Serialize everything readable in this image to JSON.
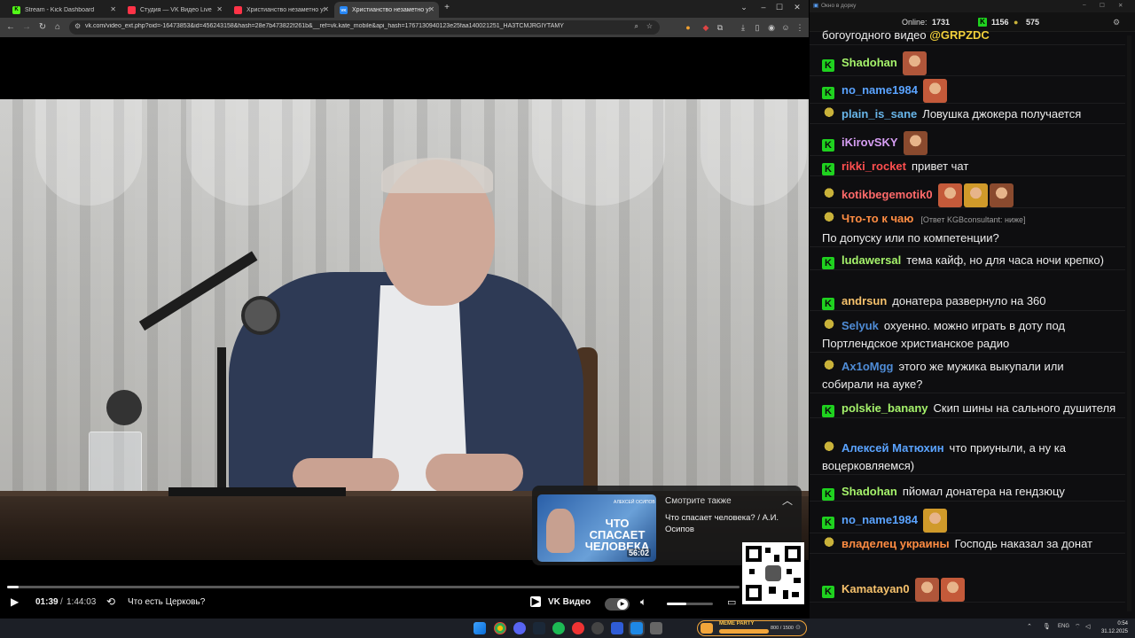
{
  "browser": {
    "tabs": [
      {
        "label": "Stream - Kick Dashboard",
        "fav_color": "#53fc18",
        "fav_glyph": "K",
        "active": false
      },
      {
        "label": "Студия — VK Видео Live",
        "fav_color": "#ff3347",
        "fav_glyph": "",
        "active": false
      },
      {
        "label": "Христианство незаметно ухо",
        "fav_color": "#ff3347",
        "fav_glyph": "",
        "active": false
      },
      {
        "label": "Христианство незаметно ухо",
        "fav_color": "#2787f5",
        "fav_glyph": "VK",
        "active": true
      }
    ],
    "new_tab": "+",
    "url": "vk.com/video_ext.php?oid=-16473853&id=456243158&hash=28e7b473822f261b&__ref=vk.kate_mobile&api_hash=1767130940123e25faa140021251_HA3TCMJRGIYTAMY"
  },
  "video": {
    "see_also_heading": "Смотрите также",
    "see_also_title": "Что спасает человека? / А.И. Осипов",
    "thumb_title": "ЧТО СПАСАЕТ ЧЕЛОВЕКА",
    "thumb_tag": "АЛЕКСЕЙ ОСИПОВ",
    "thumb_duration": "56:02",
    "current_time": "01:39",
    "total_time": "1:44:03",
    "progress_fraction": 0.016,
    "chapter": "Что есть Церковь?",
    "brand": "VK Видео",
    "volume_fraction": 0.42
  },
  "chat": {
    "window_title": "Окно в дорку",
    "online_label": "Online:",
    "online_count": "1731",
    "kick_count": "1156",
    "pepe_count": "575",
    "top_fragment": "богоугодного видео",
    "top_mention": "@GRPZDC",
    "messages": [
      {
        "badge": "kick",
        "user": "Shadohan",
        "color": "#a5f26b",
        "text": "",
        "emotes": 1,
        "reply": ""
      },
      {
        "badge": "kick",
        "user": "no_name1984",
        "color": "#5aa3ff",
        "text": "",
        "emotes": 1,
        "reply": ""
      },
      {
        "badge": "pepe",
        "user": "plain_is_sane",
        "color": "#68b5e8",
        "text": "Ловушка джокера получается",
        "emotes": 0,
        "reply": ""
      },
      {
        "badge": "kick",
        "user": "iKirovSKY",
        "color": "#d69ef3",
        "text": "",
        "emotes": 1,
        "reply": ""
      },
      {
        "badge": "kick",
        "user": "rikki_rocket",
        "color": "#ff4f4f",
        "text": "привет чат",
        "emotes": 0,
        "reply": ""
      },
      {
        "badge": "pepe",
        "user": "kotikbegemotik0",
        "color": "#ff6a6a",
        "text": "",
        "emotes": 3,
        "reply": ""
      },
      {
        "badge": "pepe",
        "user": "Что-то к чаю",
        "color": "#ff8c42",
        "text": "По допуску или по компетенции?",
        "emotes": 0,
        "reply": "[Ответ KGBconsultant: ниже]"
      },
      {
        "badge": "kick",
        "user": "ludawersal",
        "color": "#a5f26b",
        "text": "тема кайф, но для часа ночи крепко)",
        "emotes": 0,
        "reply": ""
      },
      {
        "badge": "kick",
        "user": "andrsun",
        "color": "#f5c16c",
        "text": "донатера развернуло на 360",
        "emotes": 0,
        "reply": ""
      },
      {
        "badge": "pepe",
        "user": "Selyuk",
        "color": "#4f8cd6",
        "text": "охуенно. можно играть в доту под Портлендское христианское радио",
        "emotes": 0,
        "reply": ""
      },
      {
        "badge": "pepe",
        "user": "Ax1oMgg",
        "color": "#4f8cd6",
        "text": "этого же мужика выкупали или собирали на ауке?",
        "emotes": 0,
        "reply": ""
      },
      {
        "badge": "kick",
        "user": "polskie_banany",
        "color": "#a5f26b",
        "text": "Скип шины на сального душителя",
        "emotes": 0,
        "reply": ""
      },
      {
        "badge": "pepe",
        "user": "Алексей Матюхин",
        "color": "#5aa3ff",
        "text": "что приуныли, а ну ка воцерковляемся)",
        "emotes": 0,
        "reply": ""
      },
      {
        "badge": "kick",
        "user": "Shadohan",
        "color": "#a5f26b",
        "text": "пйомал донатера на гендзюцу",
        "emotes": 0,
        "reply": ""
      },
      {
        "badge": "kick",
        "user": "no_name1984",
        "color": "#5aa3ff",
        "text": "",
        "emotes": 1,
        "reply": ""
      },
      {
        "badge": "pepe",
        "user": "владелец украины",
        "color": "#ff8c42",
        "text": "Господь наказал за донат",
        "emotes": 0,
        "reply": ""
      },
      {
        "badge": "kick",
        "user": "Kamatayan0",
        "color": "#f5c16c",
        "text": "",
        "emotes": 2,
        "reply": ""
      }
    ]
  },
  "taskbar": {
    "meme_label": "MEME PARTY",
    "meme_count": "800 / 1500",
    "lang": "ENG",
    "time": "0:54",
    "date": "31.12.2025"
  },
  "icons": {
    "back": "arrow-left",
    "forward": "arrow-right",
    "reload": "reload",
    "home": "home",
    "play": "play",
    "volume": "speaker",
    "settings": "gear"
  }
}
